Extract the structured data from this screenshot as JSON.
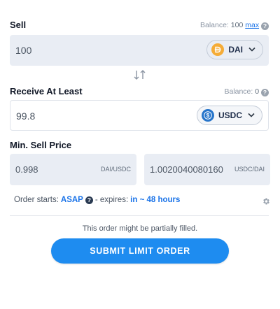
{
  "sell": {
    "label": "Sell",
    "balance_label": "Balance:",
    "balance_value": "100",
    "max_label": "max",
    "amount": "100",
    "token": "DAI",
    "help": "?"
  },
  "receive": {
    "label": "Receive At Least",
    "balance_label": "Balance:",
    "balance_value": "0",
    "amount": "99.8",
    "token": "USDC",
    "help": "?"
  },
  "min_price": {
    "label": "Min. Sell Price",
    "left_value": "0.998",
    "left_unit": "DAI/USDC",
    "right_value": "1.0020040080160",
    "right_unit": "USDC/DAI"
  },
  "order": {
    "starts_label": "Order starts:",
    "starts_value": "ASAP",
    "help": "?",
    "expires_label": "- expires:",
    "expires_value": "in ~ 48 hours"
  },
  "note": "This order might be partially filled.",
  "submit_label": "SUBMIT LIMIT ORDER",
  "colors": {
    "accent": "#1e8cf0",
    "link": "#1a73e8",
    "dai": "#f5ac37",
    "usdc": "#2775ca"
  },
  "icons": {
    "swap": "swap-arrows-icon",
    "settings": "gear-icon"
  }
}
